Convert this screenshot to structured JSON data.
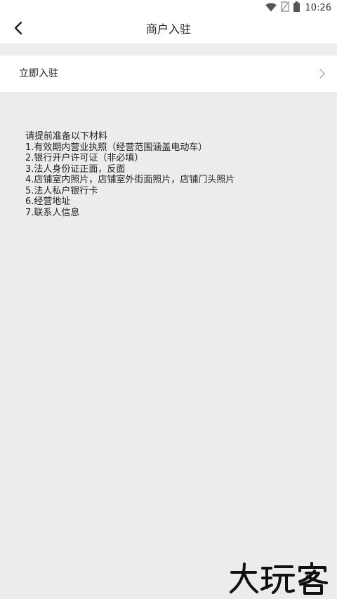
{
  "status_bar": {
    "time": "10:26",
    "icons": [
      "wifi-icon",
      "no-sim-icon",
      "battery-icon"
    ]
  },
  "header": {
    "title": "商户入驻",
    "back_icon": "chevron-left-icon"
  },
  "settle_row": {
    "label": "立即入驻",
    "icon": "chevron-right-icon"
  },
  "materials": {
    "heading": "请提前准备以下材料",
    "items": [
      "1.有效期内营业执照（经营范围涵盖电动车）",
      "2.银行开户许可证（非必填）",
      "3.法人身份证正面，反面",
      "4.店铺室内照片，店铺室外街面照片，店铺门头照片",
      "5.法人私户银行卡",
      "6.经营地址",
      "7.联系人信息"
    ]
  },
  "watermark": {
    "text": "大玩客"
  },
  "colors": {
    "background": "#ececec",
    "surface": "#ffffff",
    "text": "#222222",
    "chevron": "#b5b5b5"
  }
}
